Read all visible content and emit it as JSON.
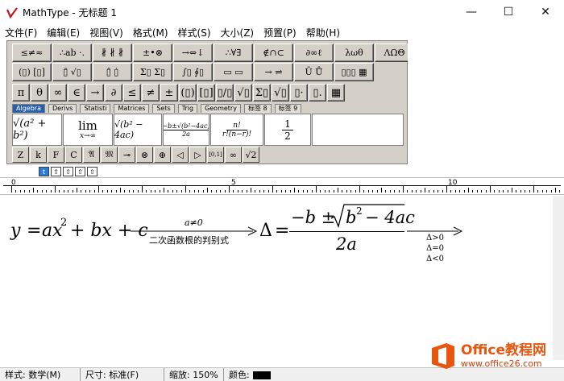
{
  "window": {
    "title": "MathType - 无标题 1",
    "controls": {
      "minimize": "—",
      "maximize": "☐",
      "close": "✕"
    }
  },
  "menu": [
    "文件(F)",
    "编辑(E)",
    "视图(V)",
    "格式(M)",
    "样式(S)",
    "大小(Z)",
    "预置(P)",
    "帮助(H)"
  ],
  "palette": {
    "row1": [
      "≤≠≈",
      "∴ab ·.",
      "∦ ∦ ∦",
      "±•⊗",
      "→⇔↓",
      "∴∀∃",
      "∉∩⊂",
      "∂∞ℓ",
      "λωθ",
      "ΛΩΘ"
    ],
    "row2": [
      "(▯) [▯]",
      "▯̄ √▯",
      "▯̂ ▯̇",
      "Σ▯ Σ▯",
      "∫▯ ∮▯",
      "▭ ▭",
      "→ ⇌",
      "Ū Ů",
      "▯▯▯ ▦"
    ],
    "row3": [
      "π",
      "θ",
      "∞",
      "∈",
      "→",
      "∂",
      "≤",
      "≠",
      "±",
      "(▯)",
      "[▯]",
      "▯/▯",
      "√▯",
      "Σ▯",
      "√▯",
      "▯·",
      "▯.",
      "▦"
    ],
    "tabs": [
      "Algebra",
      "Derivs",
      "Statisti",
      "Matrices",
      "Sets",
      "Trig",
      "Geometry",
      "标签 8",
      "标签 9"
    ],
    "active_tab": "Algebra",
    "templates": {
      "t1": "√(a² + b²)",
      "t2_top": "lim",
      "t2_bottom": "x→∞",
      "t3": "√(b² − 4ac)",
      "t4_top": "−b±√(b²−4ac)",
      "t4_bottom": "2a",
      "t5_top": "n!",
      "t5_bottom": "r!(n−r)!",
      "t6_top": "1",
      "t6_bottom": "2"
    },
    "bottom": [
      "Z",
      "k",
      "F",
      "C",
      "𝔄",
      "𝔐",
      "⊸",
      "⊗",
      "⊕",
      "◁",
      "▷",
      "[0,1]",
      "∞",
      "√2"
    ]
  },
  "small_toolbar": [
    "t",
    "⇧",
    "⇧",
    "⇧",
    "⇧"
  ],
  "ruler": {
    "labels": [
      "0",
      "5",
      "10"
    ]
  },
  "equation": {
    "lhs_y": "y",
    "eq1": "=",
    "rhs_terms": "ax",
    "sup2": "2",
    "plus_bx": "+ bx + c",
    "arrow1_top": "a≠0",
    "arrow1_bottom": "二次函数根的判别式",
    "delta": "Δ",
    "eq2": "=",
    "num_minus_b_pm": "−b ±",
    "radicand": "b",
    "radicand_sup": "2",
    "radicand_rest": "− 4ac",
    "denominator": "2a",
    "cases": [
      "Δ>0",
      "Δ=0",
      "Δ<0"
    ]
  },
  "status": {
    "style": "样式:  数学(M)",
    "size": "尺寸:  标准(F)",
    "zoom": "缩放:  150%",
    "color": "颜色:"
  },
  "watermark": {
    "brand": "Office教程网",
    "url": "www.office26.com",
    "colors": {
      "orange": "#e8550c",
      "red": "#d83b01"
    }
  }
}
